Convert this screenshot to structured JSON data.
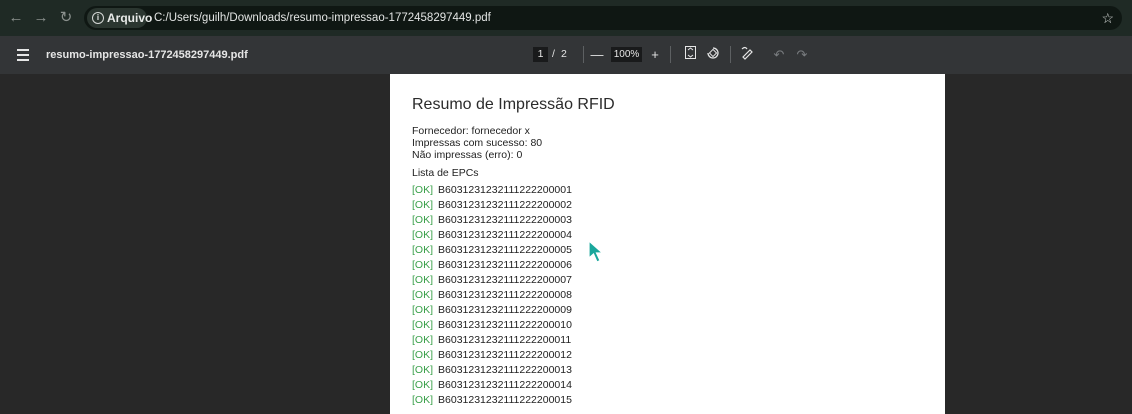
{
  "browser": {
    "back_icon": "arrow-left-icon",
    "forward_icon": "arrow-right-icon",
    "reload_icon": "reload-icon",
    "chip_label": "Arquivo",
    "url": "C:/Users/guilh/Downloads/resumo-impressao-1772458297449.pdf",
    "bookmark_icon": "star-icon"
  },
  "pdf_toolbar": {
    "filename": "resumo-impressao-1772458297449.pdf",
    "current_page": "1",
    "page_separator": "/",
    "total_pages": "2",
    "zoom": "100%",
    "zoom_out_glyph": "—",
    "zoom_in_glyph": "+"
  },
  "document": {
    "title": "Resumo de Impressão RFID",
    "fornecedor": "Fornecedor: fornecedor x",
    "impressas": "Impressas com sucesso: 80",
    "nao_impressas": "Não impressas (erro): 0",
    "list_title": "Lista de EPCs",
    "epcs": [
      {
        "status": "[OK]",
        "code": "B6031231232111222200001"
      },
      {
        "status": "[OK]",
        "code": "B6031231232111222200002"
      },
      {
        "status": "[OK]",
        "code": "B6031231232111222200003"
      },
      {
        "status": "[OK]",
        "code": "B6031231232111222200004"
      },
      {
        "status": "[OK]",
        "code": "B6031231232111222200005"
      },
      {
        "status": "[OK]",
        "code": "B6031231232111222200006"
      },
      {
        "status": "[OK]",
        "code": "B6031231232111222200007"
      },
      {
        "status": "[OK]",
        "code": "B6031231232111222200008"
      },
      {
        "status": "[OK]",
        "code": "B6031231232111222200009"
      },
      {
        "status": "[OK]",
        "code": "B6031231232111222200010"
      },
      {
        "status": "[OK]",
        "code": "B6031231232111222200011"
      },
      {
        "status": "[OK]",
        "code": "B6031231232111222200012"
      },
      {
        "status": "[OK]",
        "code": "B6031231232111222200013"
      },
      {
        "status": "[OK]",
        "code": "B6031231232111222200014"
      },
      {
        "status": "[OK]",
        "code": "B6031231232111222200015"
      }
    ]
  },
  "colors": {
    "ok_status": "#3aa04a",
    "cursor": "#1aa79c"
  }
}
